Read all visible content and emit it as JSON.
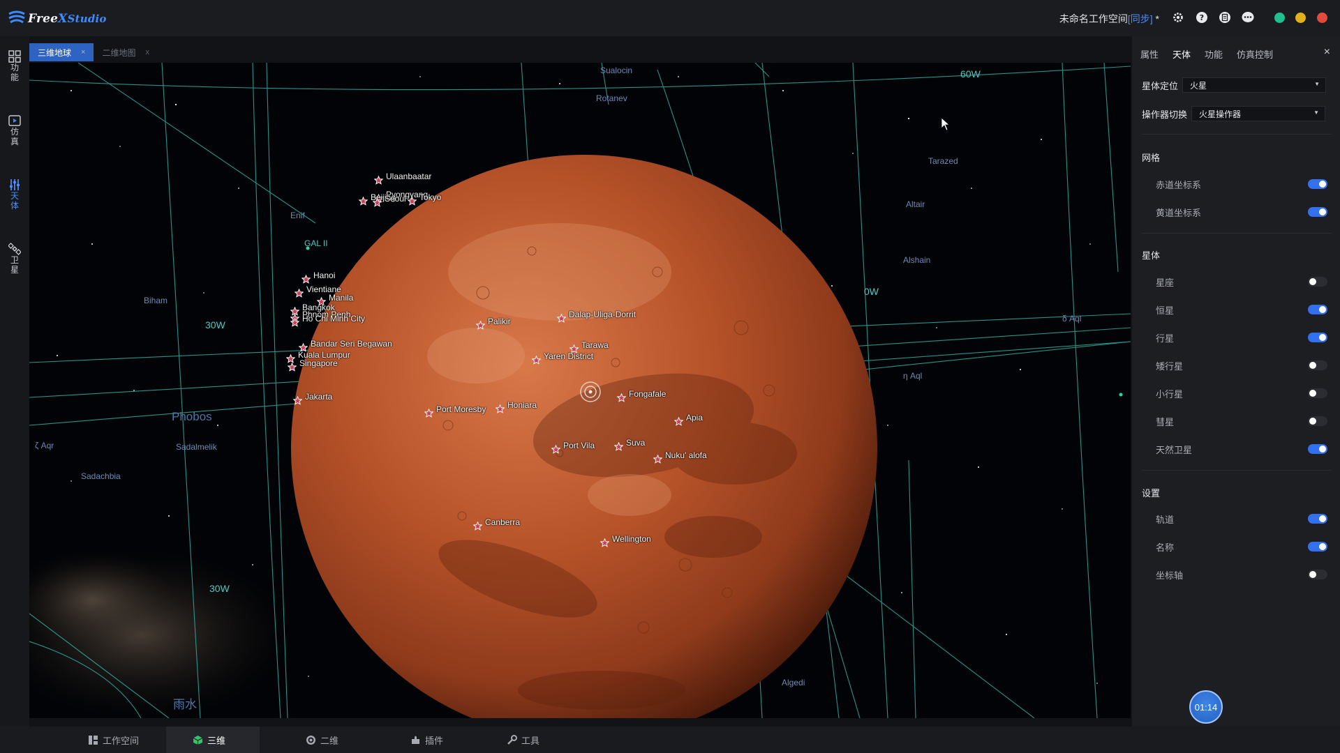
{
  "app": {
    "logo_main": "Free",
    "logo_x": "X",
    "logo_studio": "Studio",
    "workspace_name": "未命名工作空间",
    "workspace_sync": "[同步]",
    "workspace_dirty": " *",
    "toolbar_icons": [
      "settings-icon",
      "help-icon",
      "document-icon",
      "chat-icon"
    ],
    "window_buttons": {
      "maximize": "#1fbf8f",
      "minimize": "#e0b11a",
      "close": "#e24b3b"
    }
  },
  "left_rail": [
    {
      "name": "功能",
      "icon": "grid-icon"
    },
    {
      "name": "仿真",
      "icon": "simulation-icon"
    },
    {
      "name": "天体",
      "icon": "sliders-icon",
      "active": true
    },
    {
      "name": "卫星",
      "icon": "satellite-icon"
    }
  ],
  "viewport_tabs": [
    {
      "label": "三维地球",
      "close": "×",
      "active": true
    },
    {
      "label": "二维地图",
      "close": "x",
      "active": false
    }
  ],
  "scene": {
    "planet": "火星",
    "planet_color": "#b8542a",
    "cities": [
      {
        "name": "Ulaanbaatar"
      },
      {
        "name": "Pyongyang"
      },
      {
        "name": "Beijing"
      },
      {
        "name": "Seoul"
      },
      {
        "name": "Tokyo"
      },
      {
        "name": "Hanoi"
      },
      {
        "name": "Vientiane"
      },
      {
        "name": "Manila"
      },
      {
        "name": "Bangkok"
      },
      {
        "name": "Phnom Penh"
      },
      {
        "name": "Ho Chi Minh City"
      },
      {
        "name": "Bandar Seri Begawan"
      },
      {
        "name": "Kuala Lumpur"
      },
      {
        "name": "Singapore"
      },
      {
        "name": "Jakarta"
      },
      {
        "name": "Palikir"
      },
      {
        "name": "Dalap-Uliga-Dorrit"
      },
      {
        "name": "Tarawa"
      },
      {
        "name": "Yaren District"
      },
      {
        "name": "Fongafale"
      },
      {
        "name": "Port Moresby"
      },
      {
        "name": "Honiara"
      },
      {
        "name": "Apia"
      },
      {
        "name": "Port Vila"
      },
      {
        "name": "Suva"
      },
      {
        "name": "Nuku' alofa"
      },
      {
        "name": "Canberra"
      },
      {
        "name": "Wellington"
      }
    ],
    "sky_labels": [
      {
        "text": "Sualocin",
        "kind": "star"
      },
      {
        "text": "Rotanev",
        "kind": "star"
      },
      {
        "text": "60W",
        "kind": "grid"
      },
      {
        "text": "Tarazed",
        "kind": "star"
      },
      {
        "text": "Altair",
        "kind": "star"
      },
      {
        "text": "Alshain",
        "kind": "star"
      },
      {
        "text": "δ Aql",
        "kind": "star"
      },
      {
        "text": "0W",
        "kind": "grid"
      },
      {
        "text": "Enif",
        "kind": "star"
      },
      {
        "text": "GAL II",
        "kind": "grid"
      },
      {
        "text": "Biham",
        "kind": "star"
      },
      {
        "text": "30W",
        "kind": "grid"
      },
      {
        "text": "Phobos",
        "kind": "big"
      },
      {
        "text": "ζ Aqr",
        "kind": "star"
      },
      {
        "text": "Sadalmelik",
        "kind": "star"
      },
      {
        "text": "Sadachbia",
        "kind": "star"
      },
      {
        "text": "30W",
        "kind": "grid"
      },
      {
        "text": "雨水",
        "kind": "big"
      },
      {
        "text": "Algedi",
        "kind": "star"
      },
      {
        "text": "η Aql",
        "kind": "star"
      }
    ]
  },
  "panel": {
    "tabs": [
      "属性",
      "天体",
      "功能",
      "仿真控制"
    ],
    "active_tab": 1,
    "close": "×",
    "body_locate_label": "星体定位",
    "body_locate_value": "火星",
    "controller_label": "操作器切换",
    "controller_value": "火星操作器",
    "sections": [
      {
        "title": "网格",
        "items": [
          {
            "label": "赤道坐标系",
            "on": true
          },
          {
            "label": "黄道坐标系",
            "on": true
          }
        ]
      },
      {
        "title": "星体",
        "items": [
          {
            "label": "星座",
            "on": false
          },
          {
            "label": "恒星",
            "on": true
          },
          {
            "label": "行星",
            "on": true
          },
          {
            "label": "矮行星",
            "on": false
          },
          {
            "label": "小行星",
            "on": false
          },
          {
            "label": "彗星",
            "on": false
          },
          {
            "label": "天然卫星",
            "on": true
          }
        ]
      },
      {
        "title": "设置",
        "items": [
          {
            "label": "轨道",
            "on": true
          },
          {
            "label": "名称",
            "on": true
          },
          {
            "label": "坐标轴",
            "on": false
          }
        ]
      }
    ],
    "timer": "01:14"
  },
  "bottom_tabs": [
    {
      "label": "工作空间",
      "icon": "workspace-icon"
    },
    {
      "label": "三维",
      "icon": "cube-icon",
      "active": true
    },
    {
      "label": "二维",
      "icon": "globe-icon"
    },
    {
      "label": "插件",
      "icon": "plugin-icon"
    },
    {
      "label": "工具",
      "icon": "tools-icon"
    }
  ]
}
